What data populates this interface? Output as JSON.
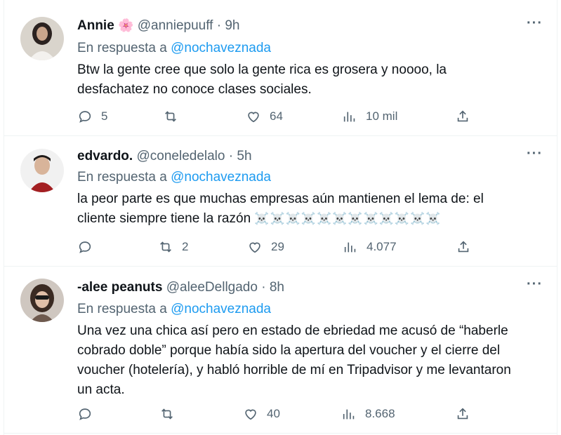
{
  "tweets": [
    {
      "name": "Annie",
      "name_emoji": "🌸",
      "handle": "@anniepuuff",
      "dot": "·",
      "time": "9h",
      "reply_prefix": "En respuesta a",
      "reply_mention": "@nochaveznada",
      "text_lines": [
        "Btw la gente cree que solo la gente rica es grosera y noooo, la",
        "desfachatez no conoce clases sociales."
      ],
      "replies": "5",
      "retweets": "",
      "likes": "64",
      "views": "10 mil"
    },
    {
      "name": "edvardo.",
      "handle": "@coneledelalo",
      "dot": "·",
      "time": "5h",
      "reply_prefix": "En respuesta a",
      "reply_mention": "@nochaveznada",
      "text_lines": [
        "la peor parte es que muchas empresas aún mantienen el lema de: el",
        "cliente siempre tiene la razón"
      ],
      "text_emoji": "☠️☠️☠️☠️☠️☠️☠️☠️☠️☠️☠️☠️",
      "replies": "",
      "retweets": "2",
      "likes": "29",
      "views": "4.077"
    },
    {
      "name": "-alee peanuts",
      "handle": "@aleeDellgado",
      "dot": "·",
      "time": "8h",
      "reply_prefix": "En respuesta a",
      "reply_mention": "@nochaveznada",
      "text_lines": [
        "Una vez una chica así pero en estado de ebriedad me acusó de “haberle",
        "cobrado doble” porque había sido la apertura del voucher y el cierre del",
        "voucher (hotelería), y habló horrible de mí en Tripadvisor y me levantaron",
        "un acta."
      ],
      "replies": "",
      "retweets": "",
      "likes": "40",
      "views": "8.668"
    }
  ],
  "icons": {
    "more": "more-dots-icon",
    "reply": "reply-icon",
    "retweet": "retweet-icon",
    "like": "heart-icon",
    "views": "views-chart-icon",
    "share": "share-icon"
  },
  "colors": {
    "accent": "#1d9bf0",
    "secondary_text": "#536471",
    "border": "#eff3f4"
  }
}
